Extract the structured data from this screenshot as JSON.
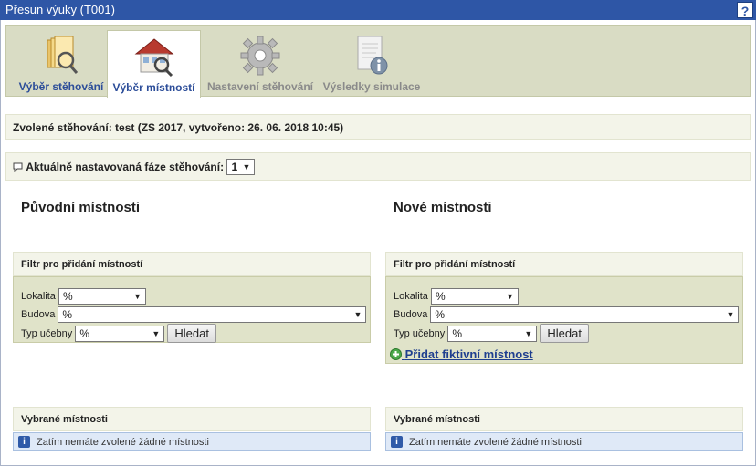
{
  "window": {
    "title": "Přesun výuky (T001)",
    "help": "?"
  },
  "tabs": [
    {
      "label": "Výběr stěhování"
    },
    {
      "label": "Výběr místností"
    },
    {
      "label": "Nastavení stěhování"
    },
    {
      "label": "Výsledky simulace"
    }
  ],
  "selected_move": "Zvolené stěhování: test (ZS 2017, vytvořeno: 26. 06. 2018 10:45)",
  "phase": {
    "label": "Aktuálně nastavovaná fáze stěhování:",
    "value": "1"
  },
  "left": {
    "title": "Původní místnosti",
    "filter_header": "Filtr pro přidání místností",
    "fields": {
      "lokalita_label": "Lokalita",
      "lokalita_value": "%",
      "budova_label": "Budova",
      "budova_value": "%",
      "typ_label": "Typ učebny",
      "typ_value": "%"
    },
    "search_button": "Hledat",
    "selected_header": "Vybrané místnosti",
    "notice": "Zatím nemáte zvolené žádné místnosti"
  },
  "right": {
    "title": "Nové místnosti",
    "filter_header": "Filtr pro přidání místností",
    "fields": {
      "lokalita_label": "Lokalita",
      "lokalita_value": "%",
      "budova_label": "Budova",
      "budova_value": "%",
      "typ_label": "Typ učebny",
      "typ_value": "%"
    },
    "search_button": "Hledat",
    "add_link": "Přidat fiktivní místnost",
    "selected_header": "Vybrané místnosti",
    "notice": "Zatím nemáte zvolené žádné místnosti"
  },
  "colors": {
    "titlebar": "#2e56a6",
    "tab_bar": "#d9dcc4",
    "panel": "#e0e3c9",
    "notice": "#dfe9f7",
    "link": "#1f3f8f"
  }
}
